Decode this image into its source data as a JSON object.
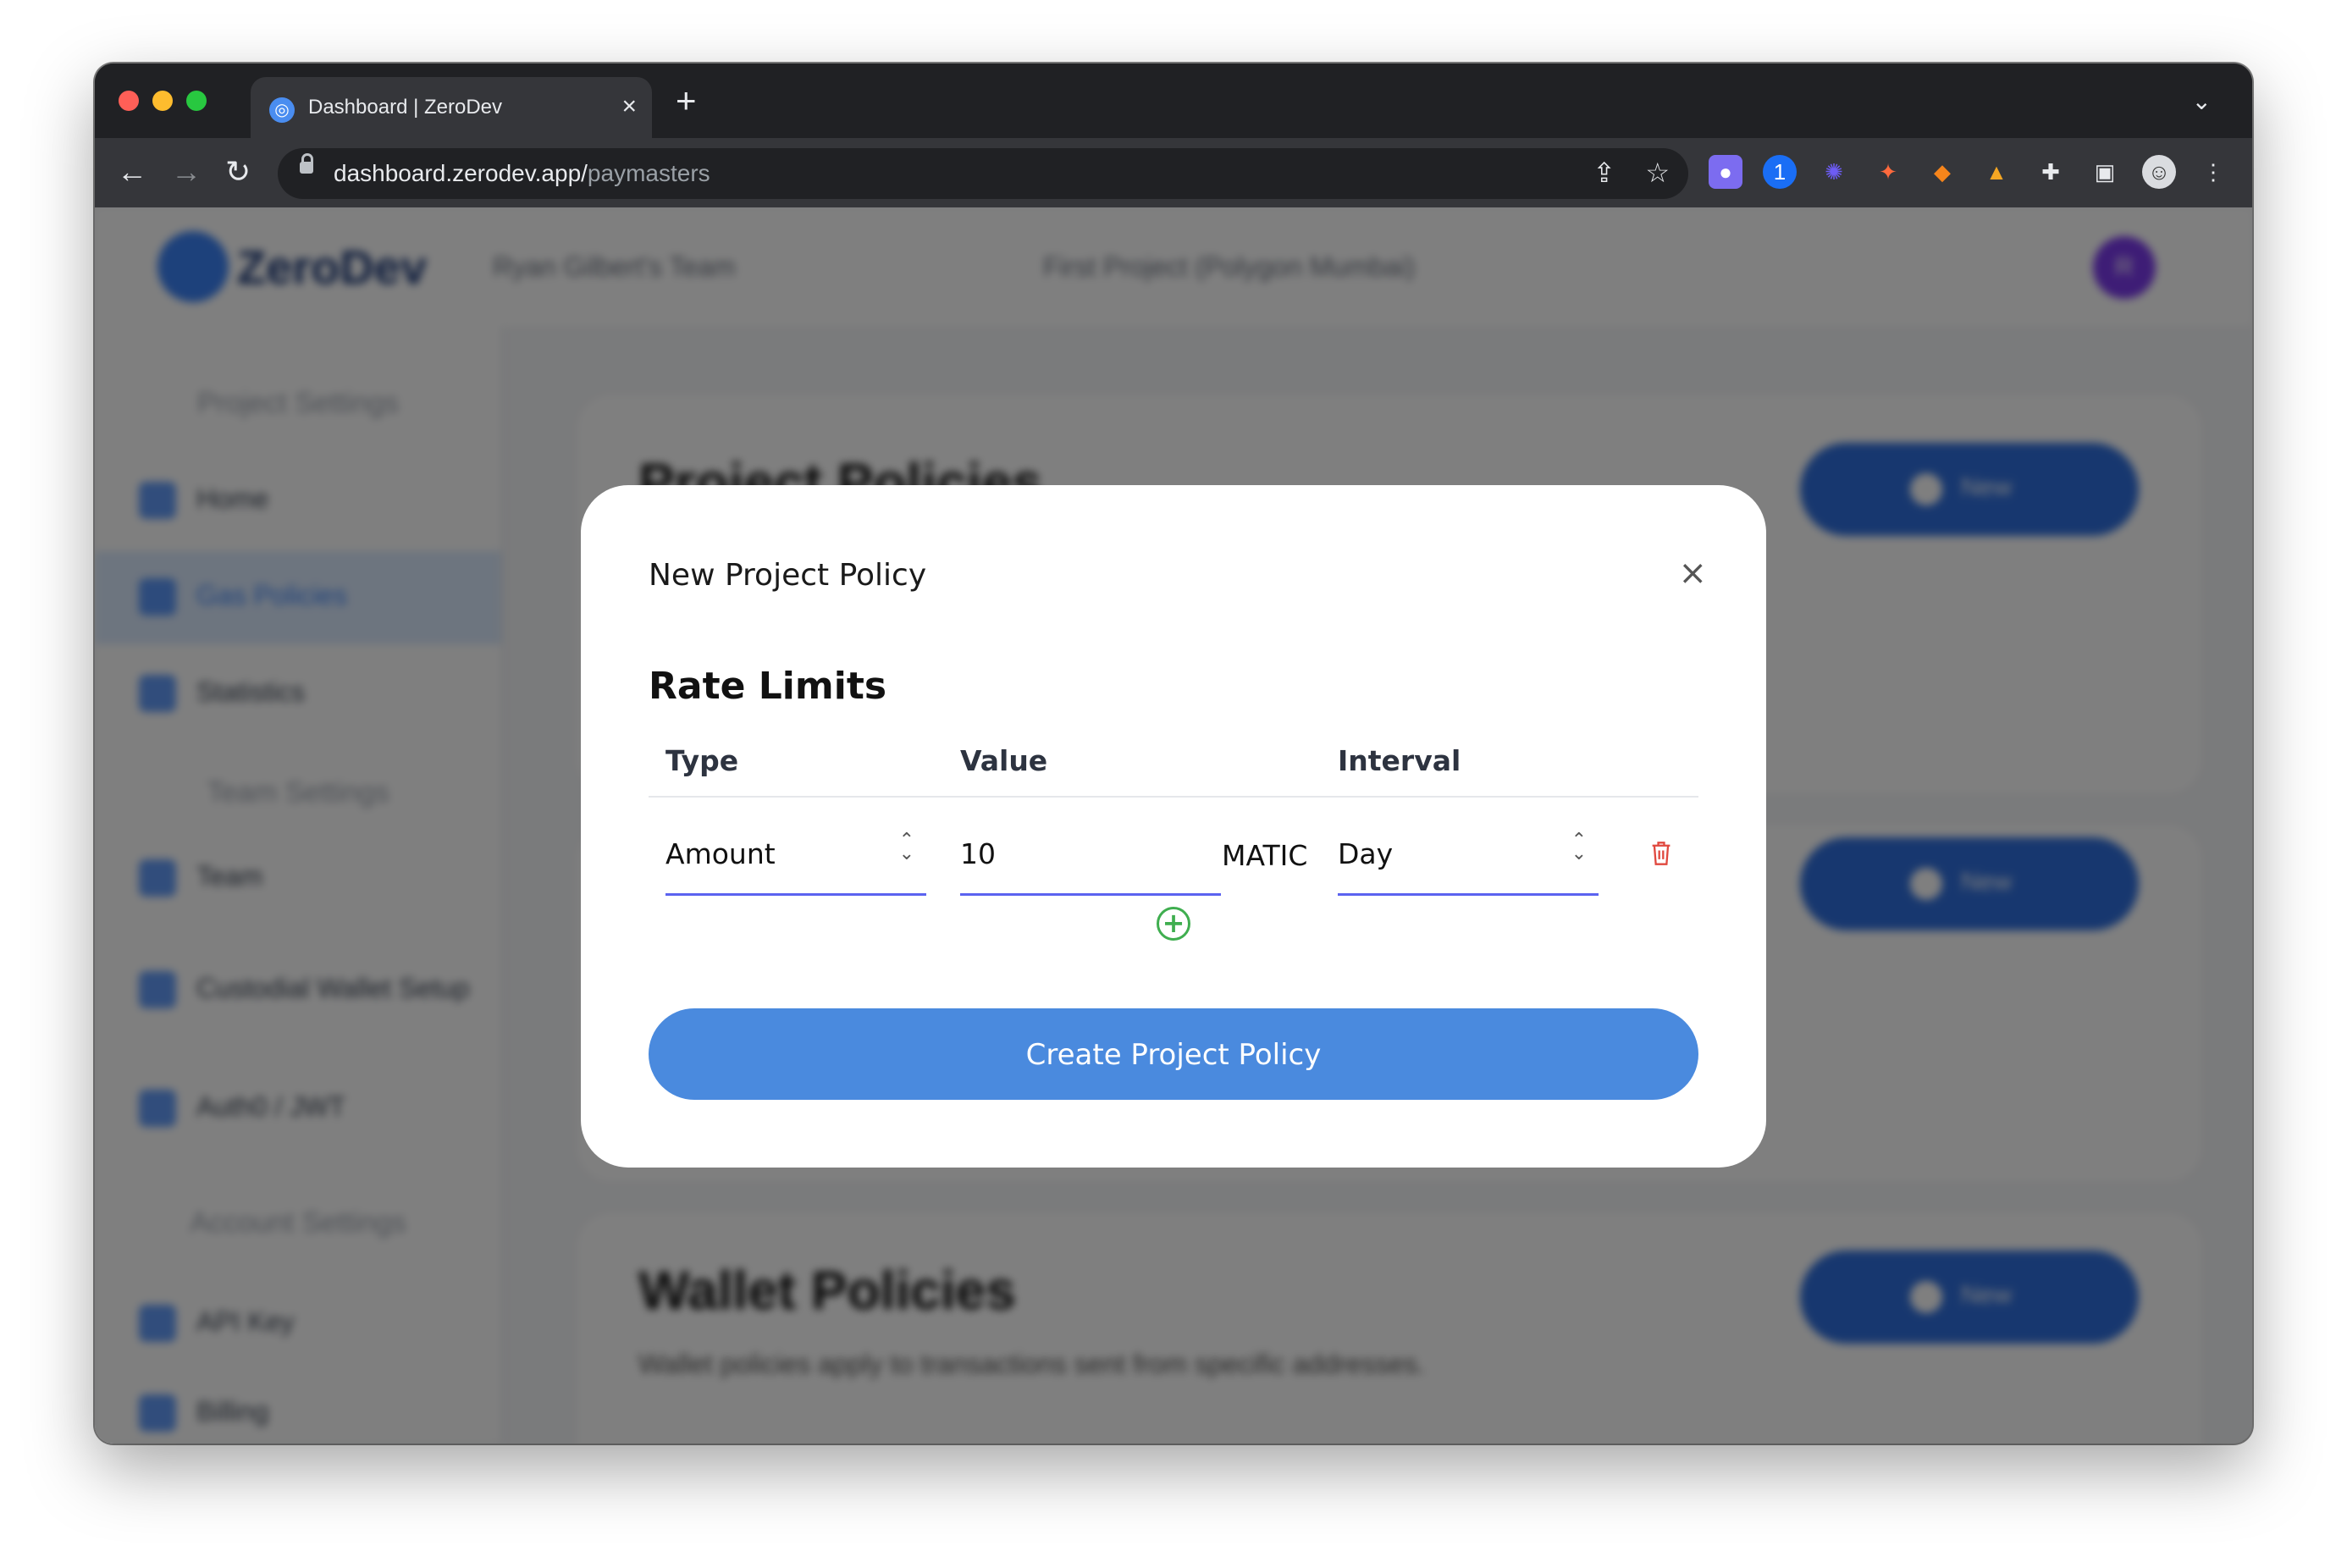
{
  "browser": {
    "tab_title": "Dashboard | ZeroDev",
    "url_host": "dashboard.zerodev.app/",
    "url_path": "paymasters",
    "close_tab_glyph": "×",
    "new_tab_glyph": "+",
    "tab_menu_glyph": "⌄",
    "extensions": [
      "ghost-extension-icon",
      "1password-icon",
      "gear-extension-icon",
      "spark-extension-icon",
      "metamask-icon",
      "fox-extension-icon",
      "puzzle-extensions-icon",
      "sidebar-toggle-icon",
      "profile-avatar-icon",
      "kebab-menu-icon"
    ]
  },
  "app": {
    "logo_text": "ZeroDev",
    "team_crumb": "Ryan Gilbert's Team",
    "project_crumb": "First Project (Polygon Mumbai)",
    "avatar_initial": "R",
    "sidebar": {
      "section_project": "Project Settings",
      "section_team": "Team Settings",
      "section_account": "Account Settings",
      "items": [
        {
          "label": "Home"
        },
        {
          "label": "Gas Policies"
        },
        {
          "label": "Statistics"
        },
        {
          "label": "Team"
        },
        {
          "label": "Custodial Wallet Setup"
        },
        {
          "label": "Auth0 / JWT"
        },
        {
          "label": "API Key"
        },
        {
          "label": "Billing"
        }
      ]
    },
    "cards": {
      "project_policies_title": "Project Policies",
      "wallet_policies_title": "Wallet Policies",
      "wallet_policies_sub": "Wallet policies apply to transactions sent from specific addresses.",
      "new_button": "New"
    }
  },
  "modal": {
    "title": "New Project Policy",
    "close_glyph": "×",
    "section_title": "Rate Limits",
    "columns": {
      "type": "Type",
      "value": "Value",
      "interval": "Interval"
    },
    "row": {
      "type": "Amount",
      "value": "10",
      "unit": "MATIC",
      "interval": "Day"
    },
    "add_glyph": "+",
    "submit_label": "Create Project Policy"
  },
  "colors": {
    "primary_button": "#4a8ade",
    "input_underline": "#5b63f0",
    "add_icon": "#3fae4f",
    "delete_icon": "#e0483e"
  }
}
